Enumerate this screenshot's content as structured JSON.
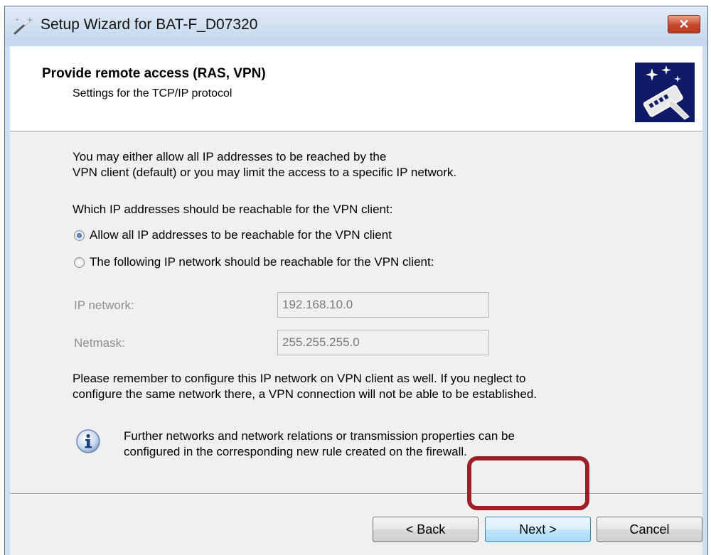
{
  "window": {
    "title": "Setup Wizard for BAT-F_D07320",
    "close_label": "✕"
  },
  "header": {
    "title": "Provide remote access (RAS, VPN)",
    "subtitle": "Settings for the TCP/IP protocol"
  },
  "content": {
    "intro_line1": "You may either allow all IP addresses to be reached by the",
    "intro_line2": "VPN client (default) or you may limit the access to a specific IP network.",
    "question": "Which IP addresses should be reachable for the VPN client:",
    "options": [
      {
        "label": "Allow all IP addresses to be reachable for the VPN client",
        "selected": true
      },
      {
        "label": "The following IP network should be reachable for the VPN client:",
        "selected": false
      }
    ],
    "ip_network": {
      "label": "IP network:",
      "value": "192.168.10.0"
    },
    "netmask": {
      "label": "Netmask:",
      "value": "255.255.255.0"
    },
    "reminder_line1": "Please remember to configure this IP network on VPN client as well. If you neglect to",
    "reminder_line2": "configure the same network there, a VPN connection will not be able to be established.",
    "info_line1": "Further networks and network relations or transmission properties can be",
    "info_line2": "configured in the corresponding new rule created on the firewall."
  },
  "buttons": {
    "back": "< Back",
    "next": "Next >",
    "cancel": "Cancel"
  },
  "colors": {
    "highlight": "#a01e28",
    "header_image_bg": "#0d1a66"
  }
}
